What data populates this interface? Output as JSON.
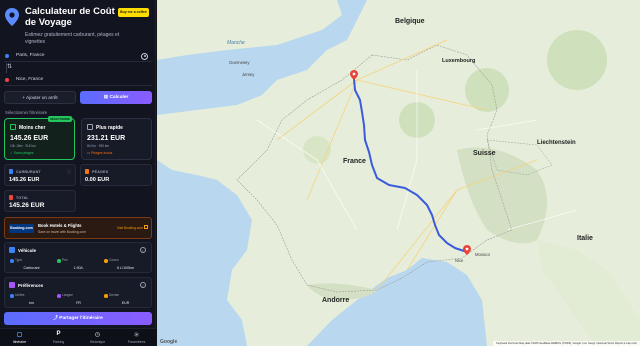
{
  "app": {
    "title": "Calculateur de Coût de Voyage",
    "subtitle": "Estimez gratuitement carburant, péages et vignettes",
    "coffee_label": "Buy me a coffee"
  },
  "route": {
    "origin": "Paris, France",
    "destination": "Nice, France",
    "add_stop_label": "Ajouter un arrêt",
    "calculate_label": "Calculer"
  },
  "routes_section_label": "Sélectionner l'itinéraire",
  "route_options": [
    {
      "name": "Moins cher",
      "price": "145.26 EUR",
      "meta": "10h 18m · 916 km",
      "tag": "Sans péages",
      "badge": "SÉLECTIONNÉ",
      "selected": true
    },
    {
      "name": "Plus rapide",
      "price": "231.21 EUR",
      "meta": "8h 0m · 930 km",
      "tag": "Péages inclus",
      "selected": false
    }
  ],
  "costs": {
    "fuel_label": "CARBURANT",
    "fuel_value": "145.26 EUR",
    "tolls_label": "PÉAGES",
    "tolls_value": "0.00 EUR",
    "total_label": "TOTAL",
    "total_value": "145.26 EUR"
  },
  "booking": {
    "logo": "Booking.com",
    "title": "Book Hotels & Flights",
    "subtitle": "Save on travel with Booking.com",
    "cta": "Visit Booking.com"
  },
  "vehicle": {
    "title": "Véhicule",
    "stats": [
      {
        "label": "Type",
        "value": "Carburant",
        "color": "#3b82f6"
      },
      {
        "label": "Prix",
        "value": "1.90/L",
        "color": "#22c55e"
      },
      {
        "label": "Conso",
        "value": "6 L/100km",
        "color": "#f59e0b"
      }
    ]
  },
  "preferences": {
    "title": "Préférences",
    "stats": [
      {
        "label": "Unités",
        "value": "km",
        "color": "#3b82f6"
      },
      {
        "label": "Langue",
        "value": "FR",
        "color": "#a855f7"
      },
      {
        "label": "Devise",
        "value": "EUR",
        "color": "#f59e0b"
      }
    ]
  },
  "share_label": "Partager l'itinéraire",
  "nav": [
    {
      "label": "Itinéraire",
      "icon": "route-icon",
      "active": true
    },
    {
      "label": "Parking",
      "icon": "parking-icon",
      "active": false
    },
    {
      "label": "Historique",
      "icon": "history-icon",
      "active": false
    },
    {
      "label": "Paramètres",
      "icon": "gear-icon",
      "active": false
    }
  ],
  "map": {
    "countries": [
      "Belgique",
      "France",
      "Suisse",
      "Andorre",
      "Italie",
      "Liechtenstein",
      "Luxembourg"
    ],
    "cities": [
      "Guernesey",
      "Jersey",
      "Monaco",
      "Nice"
    ],
    "sea_label": "Manche",
    "attribution": "Keyboard shortcuts  Map data ©2025 GeoBasis-DE/BKG (©2009), Google, Inst. Geogr. Nacional  Terms  Report a map error",
    "logo": "Google",
    "colors": {
      "route": "#3b5bdb",
      "pin": "#ea4335",
      "land": "#e8efe0",
      "water": "#a9cfe9"
    }
  }
}
